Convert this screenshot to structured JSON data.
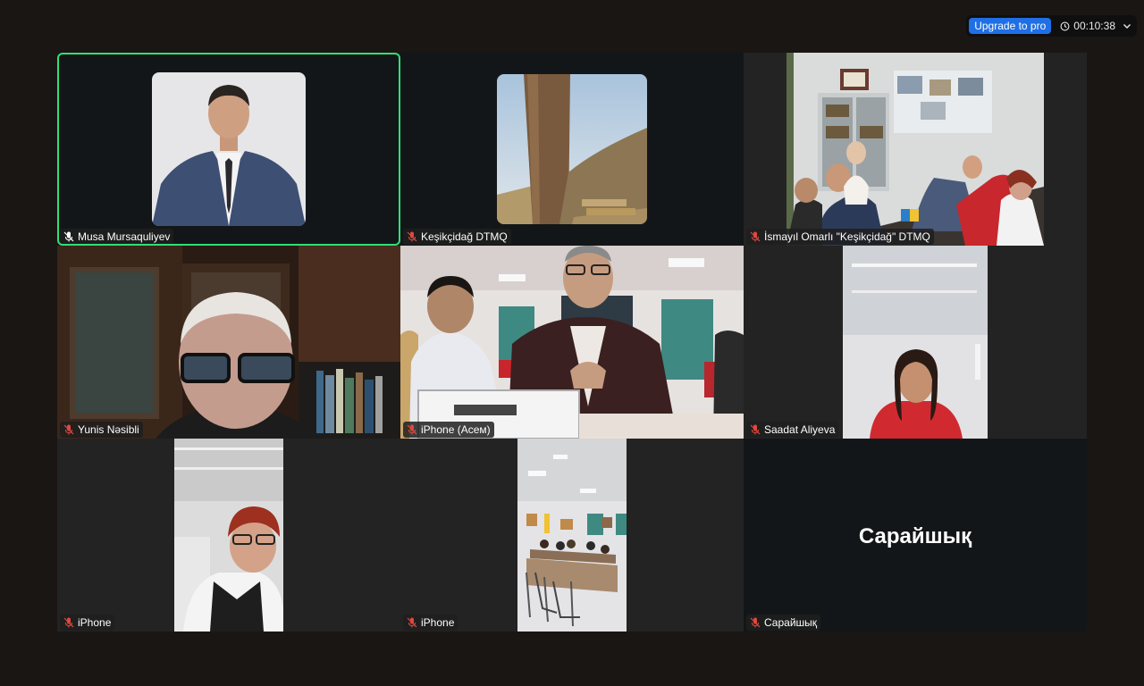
{
  "header": {
    "upgrade_label": "Upgrade to pro",
    "timer": "00:10:38",
    "clock_icon": "clock-icon",
    "chevron_icon": "chevron-down-icon"
  },
  "colors": {
    "active_speaker_border": "#2ee077",
    "upgrade_button": "#1f6fe5",
    "muted_mic": "#e0473e"
  },
  "participants": [
    {
      "name": "Musa Mursaqulіyev",
      "mic": "unmuted",
      "active": true
    },
    {
      "name": "Keşikçidağ DTMQ",
      "mic": "muted"
    },
    {
      "name": "İsmayıl Omarlı \"Keşikçidağ\" DTMQ",
      "mic": "muted"
    },
    {
      "name": "Yunis Nəsibli",
      "mic": "muted"
    },
    {
      "name": "iPhone (Асем)",
      "mic": "muted"
    },
    {
      "name": "Saadat Aliyeva",
      "mic": "muted"
    },
    {
      "name": "iPhone",
      "mic": "muted"
    },
    {
      "name": "iPhone",
      "mic": "muted"
    },
    {
      "name": "Сарайшық",
      "mic": "muted",
      "display_text": "Сарайшық"
    }
  ]
}
